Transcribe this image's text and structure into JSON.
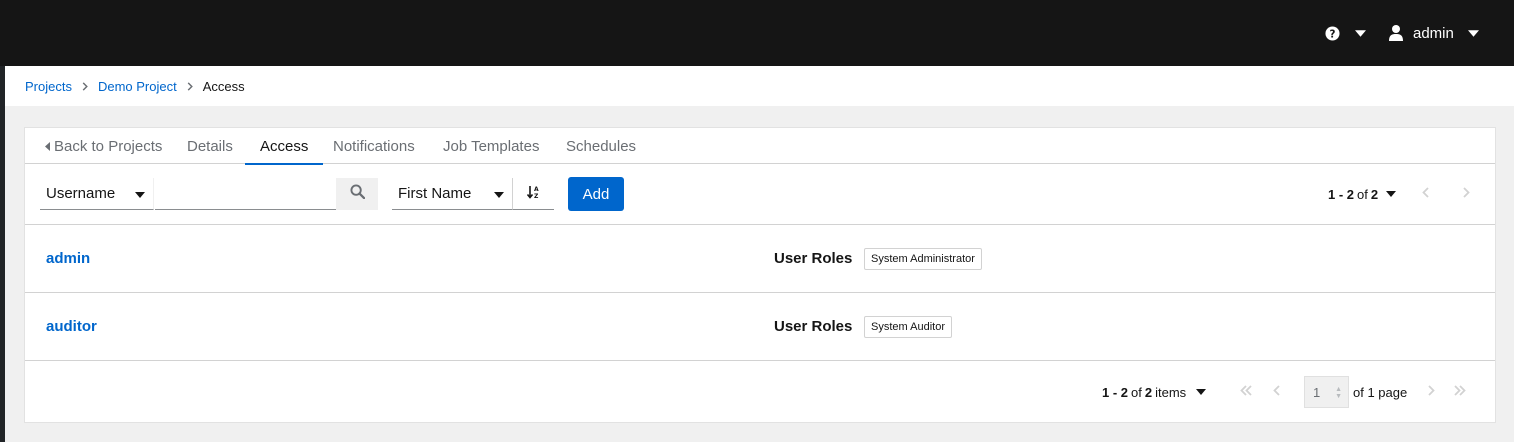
{
  "header": {
    "user_name": "admin",
    "icons": {
      "help": "help-circle-icon",
      "user": "user-icon",
      "caret": "caret-down-icon"
    }
  },
  "breadcrumb": {
    "items": [
      {
        "label": "Projects"
      },
      {
        "label": "Demo Project"
      },
      {
        "label": "Access"
      }
    ]
  },
  "tabs": [
    {
      "label": "Back to Projects"
    },
    {
      "label": "Details"
    },
    {
      "label": "Access",
      "active": true
    },
    {
      "label": "Notifications"
    },
    {
      "label": "Job Templates"
    },
    {
      "label": "Schedules"
    }
  ],
  "toolbar": {
    "search_field_selected": "Username",
    "search_value": "",
    "sort_field_selected": "First Name",
    "add_label": "Add",
    "pagination": {
      "range": "1 - 2",
      "of_label": "of",
      "total": "2"
    }
  },
  "rows": [
    {
      "username": "admin",
      "roles_label": "User Roles",
      "role": "System Administrator"
    },
    {
      "username": "auditor",
      "roles_label": "User Roles",
      "role": "System Auditor"
    }
  ],
  "footer": {
    "pagination": {
      "range": "1 - 2",
      "of_label": "of",
      "total": "2",
      "items_label": "items"
    },
    "page_value": "1",
    "of_page_label": "of 1 page"
  },
  "colors": {
    "accent": "#0066cc",
    "topbar": "#151515",
    "background": "#f0f0f0"
  }
}
